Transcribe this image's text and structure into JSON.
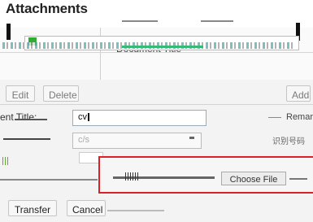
{
  "header": {
    "title": "Attachments"
  },
  "table": {
    "column_title": "Document Title"
  },
  "toolbar": {
    "edit_label": "Edit",
    "delete_label": "Delete",
    "add_label": "Add"
  },
  "form": {
    "doc_title_label": "ent Title:",
    "doc_title_value": "cv",
    "remark_label": "Remar",
    "type_value": "c/s",
    "right_note": "识别号码"
  },
  "upload": {
    "choose_label": "Choose File"
  },
  "footer": {
    "transfer_label": "Transfer",
    "cancel_label": "Cancel"
  },
  "colors": {
    "highlight": "#dd1f26",
    "accent": "#33aa33"
  }
}
